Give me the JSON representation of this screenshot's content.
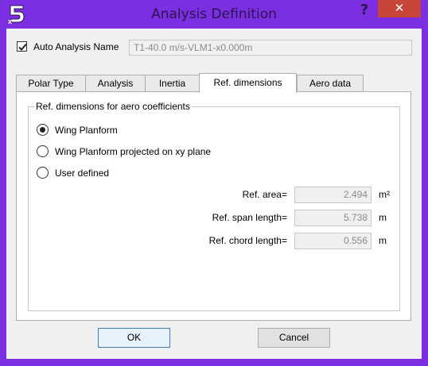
{
  "window": {
    "title": "Analysis Definition",
    "help_symbol": "?",
    "close_symbol": "✕"
  },
  "auto_analysis": {
    "label": "Auto Analysis Name",
    "checked": true,
    "value": "T1-40.0 m/s-VLM1-x0.000m"
  },
  "tabs": [
    {
      "label": "Polar Type",
      "active": false
    },
    {
      "label": "Analysis",
      "active": false
    },
    {
      "label": "Inertia",
      "active": false
    },
    {
      "label": "Ref. dimensions",
      "active": true
    },
    {
      "label": "Aero data",
      "active": false
    }
  ],
  "ref_panel": {
    "group_title": "Ref. dimensions for aero coefficients",
    "options": [
      {
        "label": "Wing Planform",
        "selected": true
      },
      {
        "label": "Wing Planform projected on xy plane",
        "selected": false
      },
      {
        "label": "User defined",
        "selected": false
      }
    ],
    "fields": [
      {
        "label": "Ref. area=",
        "value": "2.494",
        "unit": "m²"
      },
      {
        "label": "Ref. span length=",
        "value": "5.738",
        "unit": "m"
      },
      {
        "label": "Ref. chord length=",
        "value": "0.556",
        "unit": "m"
      }
    ]
  },
  "buttons": {
    "ok": "OK",
    "cancel": "Cancel"
  },
  "colors": {
    "titlebar": "#7b2fe0",
    "close": "#c7453a"
  },
  "icons": {
    "app": "xflr5-logo-icon",
    "help": "help-icon",
    "close": "close-icon"
  }
}
